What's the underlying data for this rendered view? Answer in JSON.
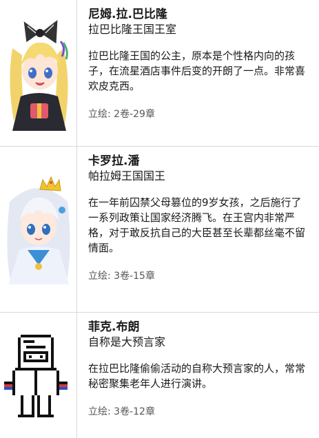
{
  "characters": [
    {
      "name": "尼姆.拉.巴比隆",
      "title": "拉巴比隆王国王室",
      "description": "拉巴比隆王国的公主，原本是个性格内向的孩子，在流星酒店事件后变的开朗了一点。非常喜欢皮克西。",
      "chapter": "立绘: 2卷-29章",
      "portrait_icon": "blonde-twintail-princess-portrait"
    },
    {
      "name": "卡罗拉.潘",
      "title": "帕拉姆王国国王",
      "description": "在一年前囚禁父母篡位的9岁女孩，之后施行了一系列政策让国家经济腾飞。在王宫内非常严格，对于敢反抗自己的大臣甚至长辈都丝毫不留情面。",
      "chapter": "立绘: 3卷-15章",
      "portrait_icon": "silver-haired-queen-portrait"
    },
    {
      "name": "菲克.布朗",
      "title": "自称是大预言家",
      "description": "在拉巴比隆偷偷活动的自称大预言家的人，常常秘密聚集老年人进行演讲。",
      "chapter": "立绘: 3卷-12章",
      "portrait_icon": "pixel-hooded-prophet-portrait"
    }
  ]
}
